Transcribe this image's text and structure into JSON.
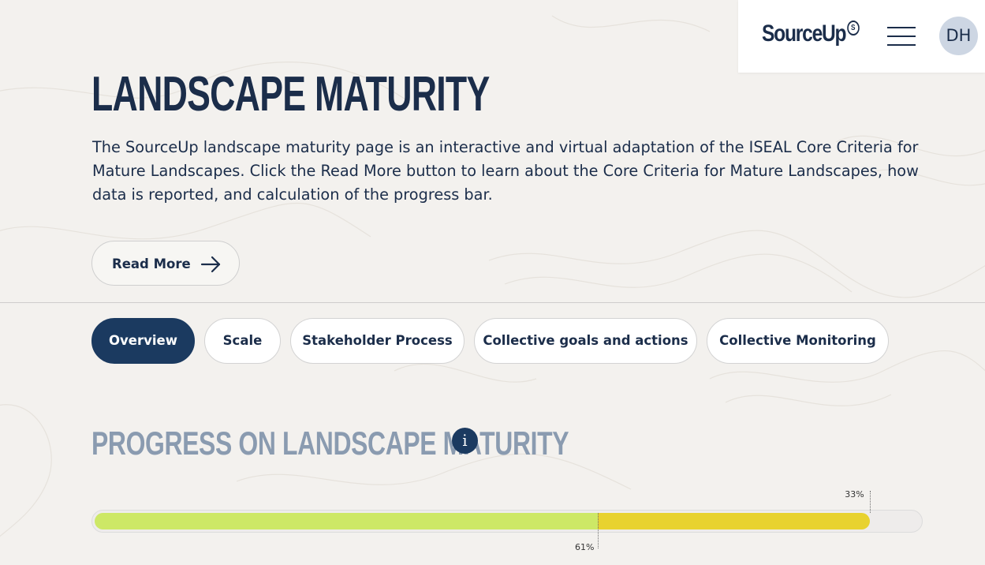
{
  "header": {
    "logo_text": "SourceUp",
    "logo_mark": "S",
    "menu_icon": "hamburger-icon",
    "avatar_initials": "DH"
  },
  "page": {
    "title": "LANDSCAPE MATURITY",
    "intro": "The SourceUp landscape maturity page is an interactive and virtual adaptation of the ISEAL Core Criteria for Mature Landscapes. Click the Read More button to learn about the Core Criteria for Mature Landscapes, how data is reported, and calculation of the progress bar.",
    "read_more_label": "Read More",
    "read_more_icon": "arrow-right-icon"
  },
  "tabs": [
    {
      "label": "Overview",
      "active": true
    },
    {
      "label": "Scale",
      "active": false
    },
    {
      "label": "Stakeholder Process",
      "active": false
    },
    {
      "label": "Collective goals and actions",
      "active": false
    },
    {
      "label": "Collective Monitoring",
      "active": false
    }
  ],
  "progress": {
    "title": "PROGRESS ON LANDSCAPE MATURITY",
    "info_icon": "info-icon",
    "info_glyph": "i",
    "segments": [
      {
        "label": "61%",
        "value": 61,
        "color": "#cde866"
      },
      {
        "label": "33%",
        "value": 33,
        "color": "#e8d22f"
      }
    ]
  },
  "colors": {
    "primary": "#1b3a60",
    "background": "#f3f1ee",
    "section_title": "#8a9bb0"
  }
}
